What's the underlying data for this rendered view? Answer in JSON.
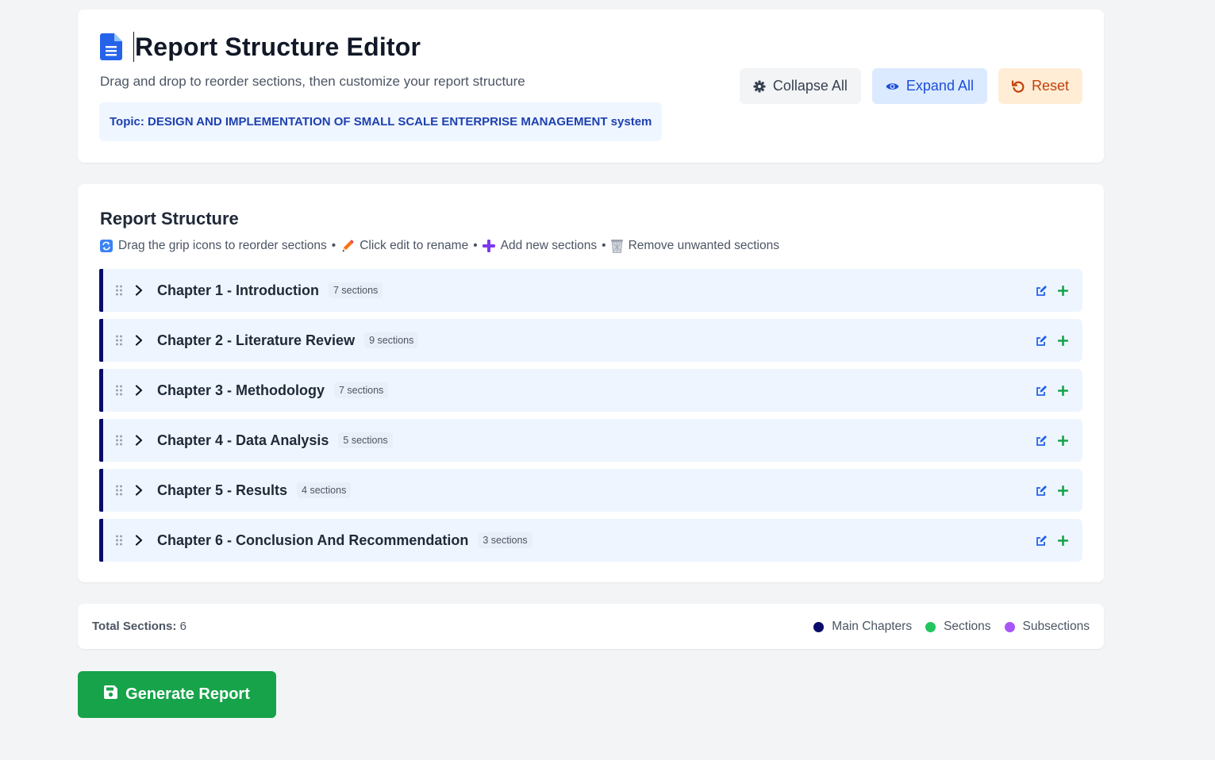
{
  "header": {
    "title": "Report Structure Editor",
    "subtitle": "Drag and drop to reorder sections, then customize your report structure",
    "topic": "Topic: DESIGN AND IMPLEMENTATION OF SMALL SCALE ENTERPRISE MANAGEMENT system",
    "buttons": {
      "collapse_label": "Collapse All",
      "expand_label": "Expand All",
      "reset_label": "Reset"
    }
  },
  "structure": {
    "title": "Report Structure",
    "hints": {
      "drag": "Drag the grip icons to reorder sections",
      "edit": "Click edit to rename",
      "add": "Add new sections",
      "remove": "Remove unwanted sections",
      "separator": "•"
    },
    "chapters": [
      {
        "title": "Chapter 1 - Introduction",
        "count": "7 sections"
      },
      {
        "title": "Chapter 2 - Literature Review",
        "count": "9 sections"
      },
      {
        "title": "Chapter 3 - Methodology",
        "count": "7 sections"
      },
      {
        "title": "Chapter 4 - Data Analysis",
        "count": "5 sections"
      },
      {
        "title": "Chapter 5 - Results",
        "count": "4 sections"
      },
      {
        "title": "Chapter 6 - Conclusion And Recommendation",
        "count": "3 sections"
      }
    ]
  },
  "footer": {
    "total_label": "Total Sections:",
    "total_value": "6",
    "legend": [
      {
        "label": "Main Chapters",
        "color": "#0b0b6b"
      },
      {
        "label": "Sections",
        "color": "#22c55e"
      },
      {
        "label": "Subsections",
        "color": "#a855f7"
      }
    ]
  },
  "generate": {
    "label": "Generate Report"
  },
  "colors": {
    "accent": "#1d4ed8",
    "primary_action": "#16a34a",
    "chapter_border": "#0b0b6b"
  }
}
